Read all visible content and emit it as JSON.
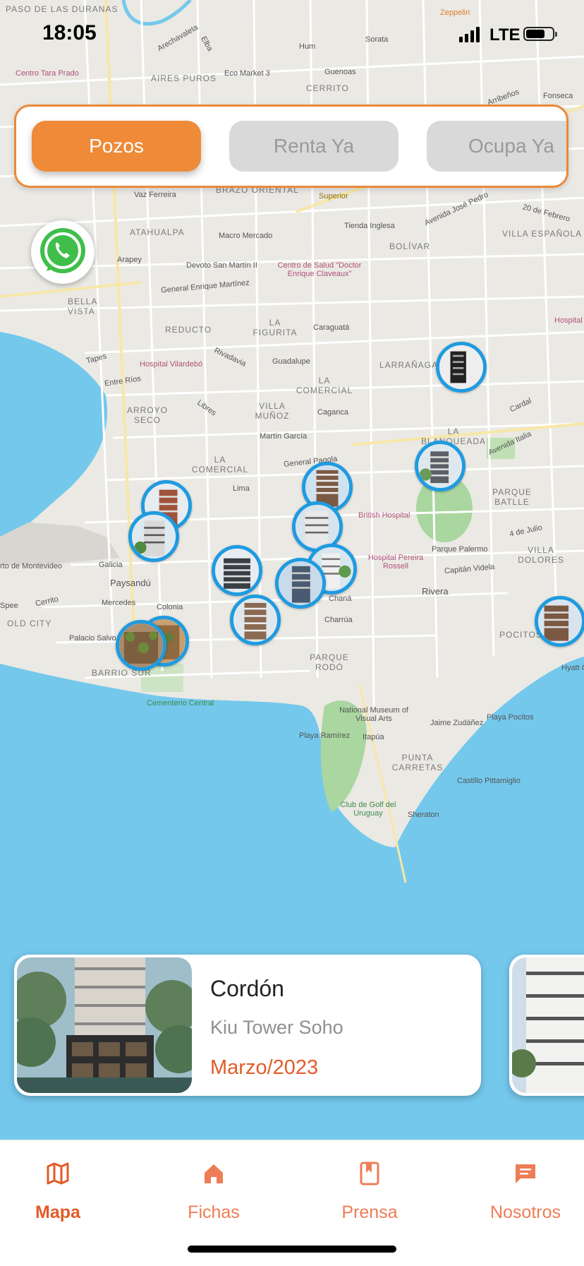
{
  "status_bar": {
    "time": "18:05",
    "network": "LTE"
  },
  "filter_tabs": [
    {
      "label": "Pozos",
      "active": true
    },
    {
      "label": "Renta Ya",
      "active": false
    },
    {
      "label": "Ocupa Ya",
      "active": false
    }
  ],
  "map": {
    "labels": {
      "paso_duranas": "PASO DE LAS DURANAS",
      "zeppelin": "Zeppelin",
      "centro_tara": "Centro Tara Prado",
      "arechavaleta": "Arechavaleta",
      "elba": "Elba",
      "hum": "Hum",
      "sorata": "Sorata",
      "aires_puros": "AIRES PUROS",
      "eco_market": "Eco Market 3",
      "cerrito": "CERRITO",
      "guenoas": "Guenoas",
      "arribenos": "Arribeños",
      "fonseca": "Fonseca",
      "vaz_ferreira": "Vaz Ferreira",
      "brazo_oriental": "BRAZO ORIENTAL",
      "superior": "Superior",
      "avenida_jose_pedro": "Avenida José Pedro",
      "febrero": "20 de Febrero",
      "atahualpa": "ATAHUALPA",
      "macro_mercado": "Macro Mercado",
      "tienda_inglesa": "Tienda Inglesa",
      "bolivar": "BOLÍVAR",
      "villa_espanola": "VILLA ESPAÑOLA",
      "arapey": "Arapey",
      "devoto": "Devoto San Martín II",
      "centro_salud": "Centro de Salud \"Doctor Enrique Claveaux\"",
      "general_martinez": "General Enrique Martínez",
      "bella_vista": "BELLA VISTA",
      "reducto": "REDUCTO",
      "la_figurita": "LA FIGURITA",
      "caraguata": "Caraguatá",
      "tapes": "Tapes",
      "hospital_vilardebo": "Hospital Vilardebó",
      "rivadavia": "Rivadavia",
      "guadalupe": "Guadalupe",
      "larranaga": "LARRAÑAGA",
      "hospital": "Hospital",
      "entre_rios": "Entre Ríos",
      "arroyo_seco": "ARROYO SECO",
      "libres": "Libres",
      "la_comercial": "LA COMERCIAL",
      "caganca": "Caganca",
      "cardal": "Cardal",
      "villa_munoz": "VILLA MUÑOZ",
      "martin_garcia": "Martín García",
      "la_blanqueada": "LA BLANQUEADA",
      "avenida_italia": "Avenida Italia",
      "la_comercial2": "LA COMERCIAL",
      "general_pagola": "General Pagola",
      "lima": "Lima",
      "parque_batlle": "PARQUE BATLLE",
      "british": "British Hospital",
      "cuatro_julio": "4 de Julio",
      "puerto_mvd": "rto de Montevideo",
      "galicia": "Galicia",
      "paysandu": "Paysandú",
      "hospital_pereira": "Hospital Pereira Rossell",
      "parque_palermo": "Parque Palermo",
      "villa_dolores": "VILLA DOLORES",
      "capitan_videla": "Capitán Videla",
      "mercedes": "Mercedes",
      "colonia": "Colonia",
      "rivera": "Rivera",
      "spee": "Spee",
      "cerrito2": "Cerrito",
      "old_city": "OLD CITY",
      "chana": "Chaná",
      "charrua": "Charrúa",
      "pocitos": "POCITOS",
      "palacio_salvo": "Palacio Salvo",
      "barrio_sur": "BARRIO SUR",
      "parque_rodo": "PARQUE RODÓ",
      "hyatt": "Hyatt C",
      "cementerio": "Cementerio Central",
      "national_museum": "National Museum of Visual Arts",
      "jaime_zudanez": "Jaime Zudáñez",
      "playa_pocitos": "Playa Pocitos",
      "playa_ramirez": "Playa Ramírez",
      "itapua": "Itapúa",
      "punta_carretas": "PUNTA CARRETAS",
      "castillo": "Castillo Pittamiglio",
      "club_golf": "Club de Golf del Uruguay",
      "sheraton": "Sheraton"
    }
  },
  "featured_card": {
    "title": "Cordón",
    "project": "Kiu Tower Soho",
    "date": "Marzo/2023"
  },
  "bottom_nav": [
    {
      "label": "Mapa",
      "icon": "map-icon",
      "active": true
    },
    {
      "label": "Fichas",
      "icon": "home-icon",
      "active": false
    },
    {
      "label": "Prensa",
      "icon": "bookmark-icon",
      "active": false
    },
    {
      "label": "Nosotros",
      "icon": "chat-icon",
      "active": false
    }
  ],
  "colors": {
    "accent": "#ee8a38",
    "pin_border": "#1f9be0",
    "water": "#74c8ec",
    "nav_active": "#e35b28"
  }
}
